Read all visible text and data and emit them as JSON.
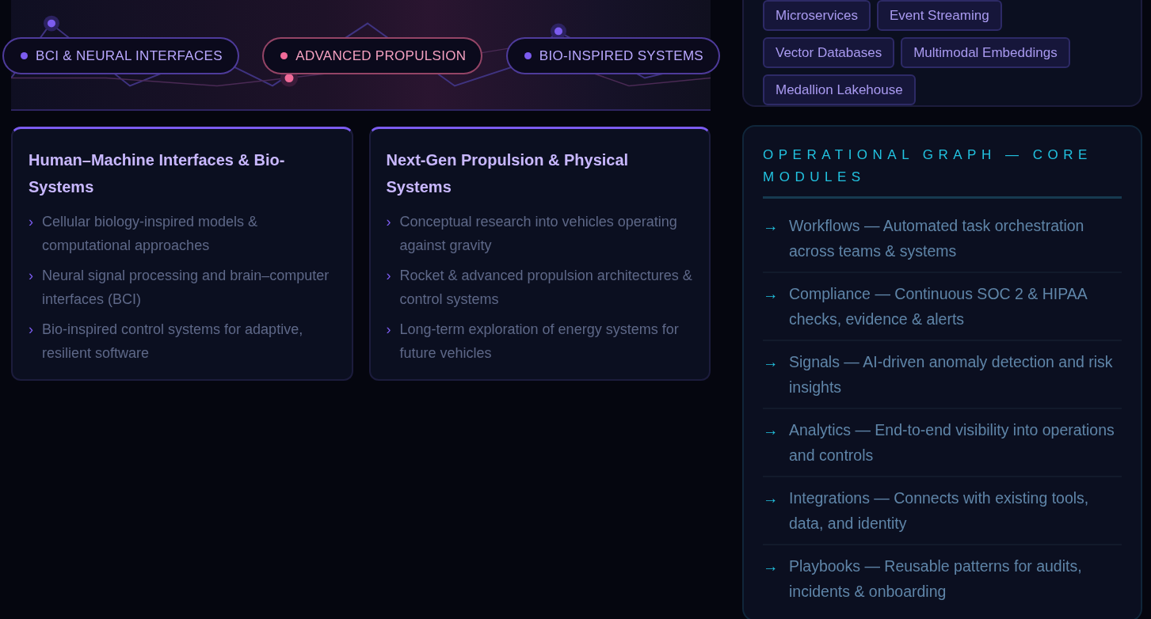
{
  "focus_pills": [
    {
      "label": "BCI & NEURAL INTERFACES",
      "color": "#7c5cf0"
    },
    {
      "label": "ADVANCED PROPULSION",
      "color": "#f06a98"
    },
    {
      "label": "BIO-INSPIRED SYSTEMS",
      "color": "#7c5cf0"
    }
  ],
  "research_cards": [
    {
      "title": "Human–Machine Interfaces & Bio-Systems",
      "bullet": "›",
      "items": [
        "Cellular biology-inspired models & computational approaches",
        "Neural signal processing and brain–computer interfaces (BCI)",
        "Bio-inspired control systems for adaptive, resilient software"
      ]
    },
    {
      "title": "Next-Gen Propulsion & Physical Systems",
      "bullet": "›",
      "items": [
        "Conceptual research into vehicles operating against gravity",
        "Rocket & advanced propulsion architectures & control systems",
        "Long-term exploration of energy systems for future vehicles"
      ]
    }
  ],
  "tech_tags": [
    "Microservices",
    "Event Streaming",
    "Vector Databases",
    "Multimodal Embeddings",
    "Medallion Lakehouse"
  ],
  "modules_card": {
    "title": "OPERATIONAL GRAPH — CORE MODULES",
    "bullet": "→",
    "items": [
      "Workflows — Automated task orchestration across teams & systems",
      "Compliance — Continuous SOC 2 & HIPAA checks, evidence & alerts",
      "Signals — AI-driven anomaly detection and risk insights",
      "Analytics — End-to-end visibility into operations and controls",
      "Integrations — Connects with existing tools, data, and identity",
      "Playbooks — Reusable patterns for audits, incidents & onboarding"
    ]
  }
}
